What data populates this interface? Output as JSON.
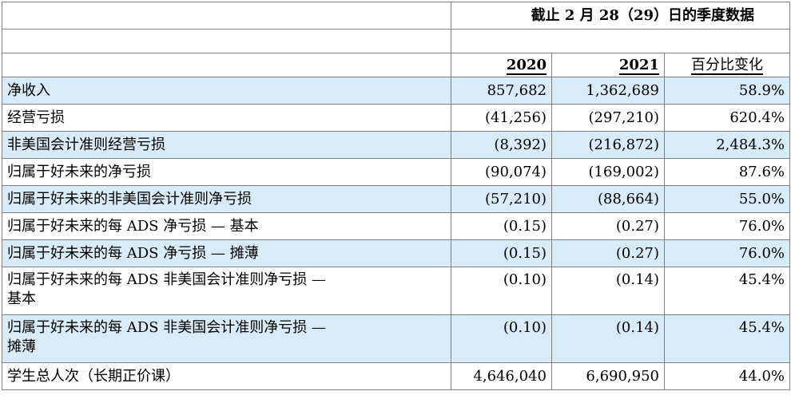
{
  "header": {
    "title": "截止 2 月 28（29）日的季度数据",
    "year1": "2020",
    "year2": "2021",
    "change": "百分比变化"
  },
  "rows": [
    {
      "label": "净收入",
      "v2020": "857,682",
      "v2021": "1,362,689",
      "pct": "58.9%"
    },
    {
      "label": "经营亏损",
      "v2020": "(41,256)",
      "v2021": "(297,210)",
      "pct": "620.4%"
    },
    {
      "label": "非美国会计准则经营亏损",
      "v2020": "(8,392)",
      "v2021": "(216,872)",
      "pct": "2,484.3%"
    },
    {
      "label": "归属于好未来的净亏损",
      "v2020": "(90,074)",
      "v2021": "(169,002)",
      "pct": "87.6%"
    },
    {
      "label": "归属于好未来的非美国会计准则净亏损",
      "v2020": "(57,210)",
      "v2021": "(88,664)",
      "pct": "55.0%"
    },
    {
      "label": "归属于好未来的每 ADS 净亏损 — 基本",
      "v2020": "(0.15)",
      "v2021": "(0.27)",
      "pct": "76.0%"
    },
    {
      "label": "归属于好未来的每 ADS 净亏损 — 摊薄",
      "v2020": "(0.15)",
      "v2021": "(0.27)",
      "pct": "76.0%"
    },
    {
      "label_line1": "归属于好未来的每 ADS 非美国会计准则净亏损 —",
      "label_line2": "基本",
      "v2020": "(0.10)",
      "v2021": "(0.14)",
      "pct": "45.4%"
    },
    {
      "label_line1": "归属于好未来的每 ADS 非美国会计准则净亏损 —",
      "label_line2": "摊薄",
      "v2020": "(0.10)",
      "v2021": "(0.14)",
      "pct": "45.4%"
    },
    {
      "label": "学生总人次（长期正价课）",
      "v2020": "4,646,040",
      "v2021": "6,690,950",
      "pct": "44.0%"
    }
  ]
}
